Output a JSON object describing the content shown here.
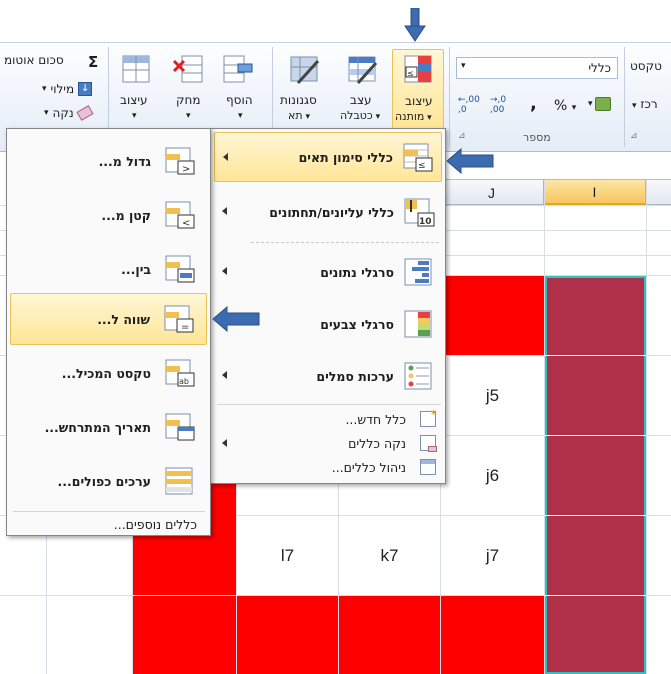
{
  "ribbon": {
    "editing": {
      "autosum_label": "סכום אוטומ",
      "fill_label": "מילוי",
      "clear_label": "נקה"
    },
    "cells": {
      "format_label": "עיצוב",
      "delete_label": "מחק",
      "insert_label": "הוסף"
    },
    "styles": {
      "cell_styles_label_1": "סגנונות",
      "cell_styles_label_2": "תא",
      "format_table_label_1": "עצב",
      "format_table_label_2": "כטבלה",
      "conditional_label_1": "עיצוב",
      "conditional_label_2": "מותנה"
    },
    "number": {
      "format_combo_value": "כללי",
      "group_label": "מספר",
      "percent_symbol": "%",
      "comma_symbol": ",",
      "increase_decimal": ",00\n,0",
      "decrease_decimal": ",0\n,00"
    },
    "alignment": {
      "wrap_text_label": "טקסט",
      "merge_label": "רכז"
    }
  },
  "columns": {
    "j_header": "J",
    "i_header": "I"
  },
  "cells": {
    "j5": "j5",
    "j6": "j6",
    "j7": "j7",
    "k7": "k7",
    "l7": "l7"
  },
  "main_menu": {
    "highlight_rules": "כללי סימון תאים",
    "top_bottom_rules": "כללי עליונים/תחתונים",
    "data_bars": "סרגלי נתונים",
    "color_scales": "סרגלי צבעים",
    "icon_sets": "ערכות סמלים",
    "new_rule": "כלל חדש...",
    "clear_rules": "נקה כללים",
    "manage_rules": "ניהול כללים..."
  },
  "sub_menu": {
    "greater_than": "גדול מ...",
    "less_than": "קטן מ...",
    "between": "בין...",
    "equal_to": "שווה ל...",
    "text_contains": "טקסט המכיל...",
    "date_occurring": "תאריך המתרחש...",
    "duplicate_values": "ערכים כפולים...",
    "more_rules": "כללים נוספים..."
  },
  "colors": {
    "red_fill": "#ff0000",
    "maroon_fill": "#b0304a",
    "pointer_arrow": "#2b5797",
    "menu_highlight": "#ffe596"
  }
}
